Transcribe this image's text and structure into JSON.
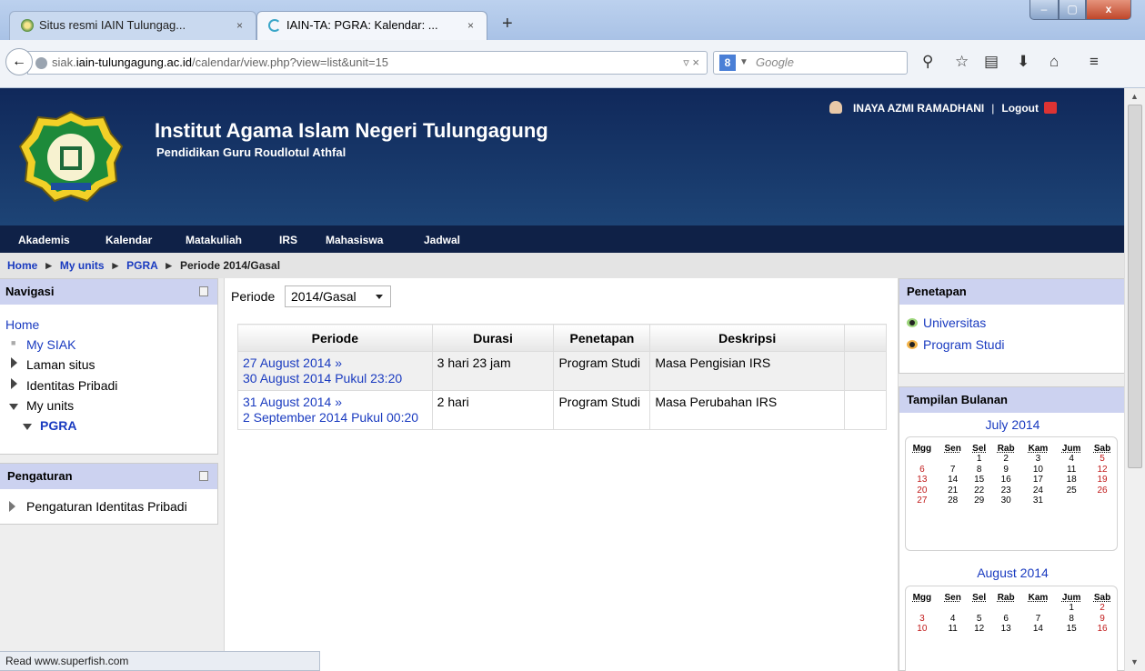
{
  "browser": {
    "tabs": [
      {
        "title": "Situs resmi IAIN Tulungag...",
        "close": "×"
      },
      {
        "title": "IAIN-TA: PGRA: Kalendar: ...",
        "close": "×"
      }
    ],
    "new_tab": "+",
    "url_prefix": "siak.",
    "url_host": "iain-tulungagung.ac.id",
    "url_path": "/calendar/view.php?view=list&unit=15",
    "url_controls": "▿ ×",
    "search_engine_letter": "8",
    "search_placeholder": "Google",
    "window_buttons": {
      "minimize": "–",
      "maximize": "▢",
      "close": "x"
    }
  },
  "header": {
    "title": "Institut Agama Islam Negeri Tulungagung",
    "subtitle": "Pendidikan Guru Roudlotul Athfal",
    "user_name": "INAYA AZMI RAMADHANI",
    "separator": "|",
    "logout": "Logout"
  },
  "menu": [
    "Akademis",
    "Kalendar",
    "Matakuliah",
    "IRS",
    "Mahasiswa",
    "Jadwal"
  ],
  "breadcrumb": {
    "items": [
      "Home",
      "My units",
      "PGRA"
    ],
    "current": "Periode 2014/Gasal",
    "separator": "►"
  },
  "left": {
    "nav_title": "Navigasi",
    "nav_items": {
      "home": "Home",
      "my_siak": "My SIAK",
      "laman": "Laman situs",
      "identitas": "Identitas Pribadi",
      "my_units": "My units",
      "pgra": "PGRA"
    },
    "settings_title": "Pengaturan",
    "settings_item": "Pengaturan Identitas Pribadi"
  },
  "main": {
    "periode_label": "Periode",
    "periode_value": "2014/Gasal",
    "table": {
      "headers": [
        "Periode",
        "Durasi",
        "Penetapan",
        "Deskripsi",
        ""
      ],
      "rows": [
        {
          "start": "27 August 2014 »",
          "end": "30 August 2014 Pukul 23:20",
          "durasi": "3 hari 23 jam",
          "penetapan": "Program Studi",
          "deskripsi": "Masa Pengisian IRS"
        },
        {
          "start": "31 August 2014 »",
          "end": "2 September 2014 Pukul 00:20",
          "durasi": "2 hari",
          "penetapan": "Program Studi",
          "deskripsi": "Masa Perubahan IRS"
        }
      ]
    }
  },
  "right": {
    "penetapan_title": "Penetapan",
    "legend": [
      "Universitas",
      "Program Studi"
    ],
    "monthly_title": "Tampilan Bulanan",
    "weekdays": [
      "Mgg",
      "Sen",
      "Sel",
      "Rab",
      "Kam",
      "Jum",
      "Sab"
    ],
    "months": [
      {
        "title": "July 2014",
        "first_weekday": 2,
        "days": 31
      },
      {
        "title": "August 2014",
        "first_weekday": 5,
        "days": 16
      }
    ]
  },
  "status_bar": "Read www.superfish.com",
  "colors": {
    "header": "#1d4476",
    "menubar": "#0f2147",
    "link": "#1a3bc0",
    "block_head": "#ccd2f0",
    "weekend": "#c01818"
  }
}
